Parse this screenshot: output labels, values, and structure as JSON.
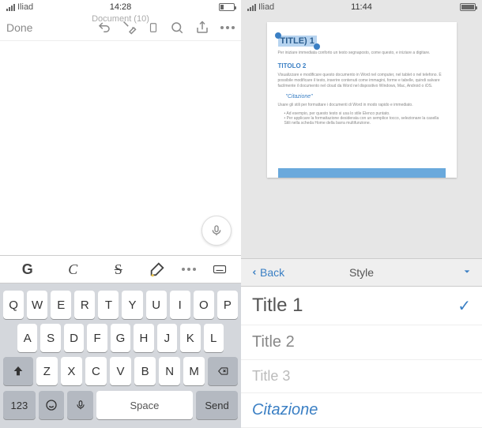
{
  "left": {
    "status": {
      "carrier": "Iliad",
      "time": "14:28"
    },
    "header": {
      "done": "Done",
      "title": "Document (10)"
    },
    "format": {
      "bold": "G",
      "italic": "C",
      "strike": "S",
      "more": "..."
    },
    "keyboard": {
      "r1": [
        "Q",
        "W",
        "E",
        "R",
        "T",
        "Y",
        "U",
        "I",
        "O",
        "P"
      ],
      "r2": [
        "A",
        "S",
        "D",
        "F",
        "G",
        "H",
        "J",
        "K",
        "L"
      ],
      "r3": [
        "Z",
        "X",
        "C",
        "V",
        "B",
        "N",
        "M"
      ],
      "k123": "123",
      "space": "Space",
      "send": "Send"
    }
  },
  "right": {
    "status": {
      "carrier": "Iliad",
      "time": "11:44"
    },
    "doc": {
      "title_sel": "TITLE) 1",
      "h2": "TITOLO 2",
      "quote": "\"Citazione\""
    },
    "stylebar": {
      "back": "Back",
      "title": "Style"
    },
    "styles": {
      "t1": "Title 1",
      "t2": "Title 2",
      "t3": "Title 3",
      "cit": "Citazione"
    }
  }
}
